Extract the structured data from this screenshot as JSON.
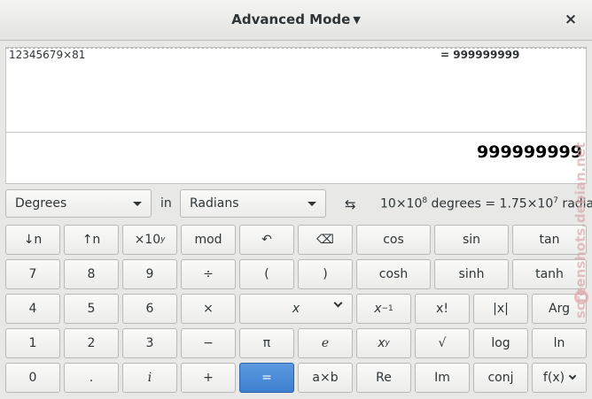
{
  "window": {
    "title": "Advanced Mode",
    "close_label": "×"
  },
  "history": {
    "expression": "12345679×81",
    "result": "= 999999999"
  },
  "display": {
    "value": "999999999"
  },
  "conversion": {
    "from_unit": "Degrees",
    "in_label": "in",
    "to_unit": "Radians",
    "swap_glyph": "⇆",
    "result_mantissa1": "10×10",
    "result_exp1": "8",
    "result_mid": " degrees = 1.75×10",
    "result_exp2": "7",
    "result_tail": " radians"
  },
  "keys": {
    "down_n": "↓n",
    "up_n": "↑n",
    "times10": "×10",
    "times10_exp": "y",
    "mod": "mod",
    "undo": "↶",
    "backspace": "⌫",
    "cos": "cos",
    "sin": "sin",
    "tan": "tan",
    "k7": "7",
    "k8": "8",
    "k9": "9",
    "divide": "÷",
    "lparen": "(",
    "rparen": ")",
    "cosh": "cosh",
    "sinh": "sinh",
    "tanh": "tanh",
    "k4": "4",
    "k5": "5",
    "k6": "6",
    "multiply": "×",
    "var_x": "x",
    "inverse_base": "x",
    "inverse_exp": "−1",
    "factorial": "x!",
    "abs": "|x|",
    "arg": "Arg",
    "k1": "1",
    "k2": "2",
    "k3": "3",
    "minus": "−",
    "pi": "π",
    "e": "e",
    "power_base": "x",
    "power_exp": "y",
    "sqrt": "√",
    "log": "log",
    "ln": "ln",
    "k0": "0",
    "point": ".",
    "imag": "i",
    "plus": "+",
    "equals": "=",
    "atimesb": "a×b",
    "re": "Re",
    "im": "Im",
    "conj": "conj",
    "fx": "f(x)"
  },
  "watermark": "screenshots.debian.net"
}
